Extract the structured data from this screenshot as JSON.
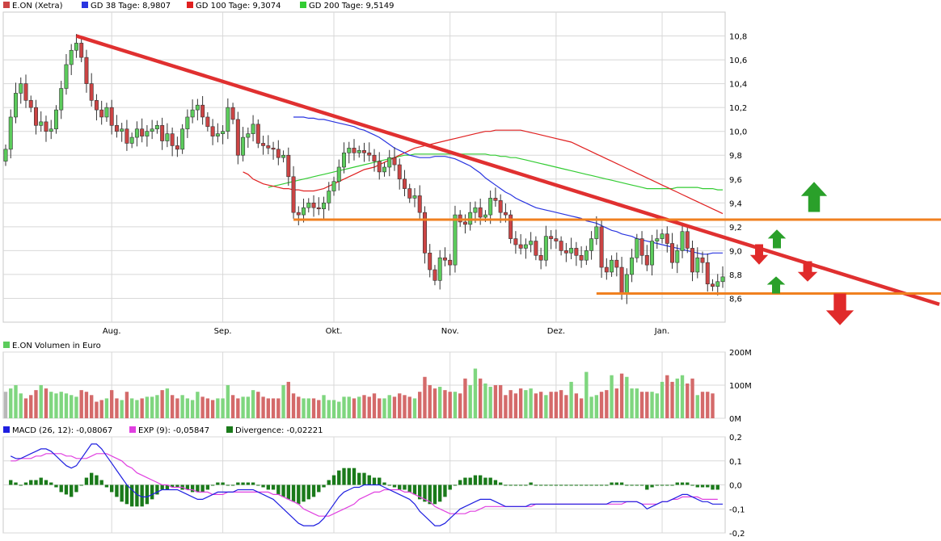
{
  "colors": {
    "bull": "#5ccc5c",
    "bear": "#cc4444",
    "sma38": "#2a35e0",
    "sma100": "#e02020",
    "sma200": "#33cc33",
    "trendline": "#e03030",
    "support": "#f08020",
    "arrow_up": "#2aa02a",
    "arrow_down": "#e02a2a",
    "vol_bull": "#7fd67f",
    "vol_bear": "#d46a6a",
    "vol_neutral": "#b8b8b8",
    "macd": "#2020e0",
    "signal": "#e040e0",
    "divergence": "#1a7a1a",
    "grid": "#d8d8d8"
  },
  "chart_data": [
    {
      "type": "candlestick",
      "legend": [
        {
          "label": "E.ON (Xetra)",
          "color": "#cc4444"
        },
        {
          "label": "GD 38 Tage: 8,9807",
          "color": "#2a35e0"
        },
        {
          "label": "GD 100 Tage: 9,3074",
          "color": "#e02020"
        },
        {
          "label": "GD 200 Tage: 9,5149",
          "color": "#33cc33"
        }
      ],
      "ylim": [
        8.4,
        11.0
      ],
      "yticks": [
        "10,8",
        "10,6",
        "10,4",
        "10,2",
        "10,0",
        "9,8",
        "9,6",
        "9,4",
        "9,2",
        "9,0",
        "8,8",
        "8,6"
      ],
      "ytick_values": [
        10.8,
        10.6,
        10.4,
        10.2,
        10.0,
        9.8,
        9.6,
        9.4,
        9.2,
        9.0,
        8.8,
        8.6
      ],
      "months": [
        {
          "label": "Aug.",
          "index": 21
        },
        {
          "label": "Sep.",
          "index": 43
        },
        {
          "label": "Okt.",
          "index": 65
        },
        {
          "label": "Nov.",
          "index": 88
        },
        {
          "label": "Dez.",
          "index": 109
        },
        {
          "label": "Jan.",
          "index": 130
        }
      ],
      "closes": [
        9.85,
        10.12,
        10.32,
        10.4,
        10.26,
        10.2,
        10.05,
        10.08,
        10.0,
        10.02,
        10.18,
        10.36,
        10.56,
        10.68,
        10.74,
        10.62,
        10.4,
        10.26,
        10.18,
        10.12,
        10.2,
        10.05,
        10.0,
        10.02,
        9.9,
        9.95,
        10.02,
        9.96,
        10.0,
        10.02,
        10.05,
        9.92,
        9.98,
        9.88,
        9.85,
        10.02,
        10.12,
        10.18,
        10.22,
        10.12,
        10.04,
        9.96,
        9.98,
        10.0,
        10.2,
        10.1,
        9.8,
        9.95,
        9.98,
        10.06,
        9.9,
        9.88,
        9.86,
        9.85,
        9.78,
        9.8,
        9.62,
        9.32,
        9.3,
        9.36,
        9.4,
        9.36,
        9.35,
        9.4,
        9.5,
        9.58,
        9.7,
        9.82,
        9.86,
        9.82,
        9.84,
        9.82,
        9.8,
        9.75,
        9.66,
        9.7,
        9.78,
        9.72,
        9.6,
        9.52,
        9.44,
        9.46,
        9.32,
        8.98,
        8.84,
        8.75,
        8.94,
        8.92,
        8.88,
        9.3,
        9.24,
        9.22,
        9.32,
        9.36,
        9.28,
        9.3,
        9.44,
        9.42,
        9.32,
        9.3,
        9.1,
        9.05,
        9.02,
        9.05,
        9.08,
        8.96,
        8.92,
        9.12,
        9.1,
        9.08,
        9.0,
        8.98,
        9.02,
        8.96,
        8.92,
        9.0,
        9.1,
        9.2,
        8.86,
        8.82,
        8.92,
        8.86,
        8.64,
        8.8,
        8.94,
        9.1,
        8.96,
        8.88,
        9.08,
        9.1,
        9.14,
        9.06,
        8.9,
        9.0,
        9.16,
        9.02,
        8.82,
        8.94,
        8.9,
        8.72,
        8.7,
        8.74,
        8.78
      ],
      "sma38": [
        null,
        null,
        null,
        null,
        null,
        null,
        null,
        null,
        null,
        null,
        null,
        null,
        null,
        null,
        null,
        null,
        null,
        null,
        null,
        null,
        null,
        null,
        null,
        null,
        null,
        null,
        null,
        null,
        null,
        null,
        null,
        null,
        null,
        null,
        null,
        null,
        null,
        null,
        10.12,
        10.12,
        10.12,
        10.11,
        10.11,
        10.1,
        10.1,
        10.09,
        10.08,
        10.07,
        10.06,
        10.05,
        10.04,
        10.02,
        10.01,
        9.99,
        9.97,
        9.95,
        9.92,
        9.89,
        9.86,
        9.84,
        9.82,
        9.8,
        9.79,
        9.78,
        9.78,
        9.78,
        9.79,
        9.79,
        9.79,
        9.78,
        9.77,
        9.75,
        9.73,
        9.71,
        9.68,
        9.65,
        9.61,
        9.58,
        9.55,
        9.52,
        9.49,
        9.47,
        9.44,
        9.42,
        9.4,
        9.38,
        9.36,
        9.35,
        9.34,
        9.33,
        9.32,
        9.31,
        9.3,
        9.29,
        9.28,
        9.27,
        9.25,
        9.24,
        9.23,
        9.21,
        9.19,
        9.17,
        9.16,
        9.14,
        9.13,
        9.12,
        9.1,
        9.09,
        9.08,
        9.07,
        9.06,
        9.05,
        9.04,
        9.03,
        9.02,
        9.01,
        9.0,
        8.99,
        8.98,
        8.97,
        8.97,
        8.98,
        8.98,
        8.98
      ],
      "sma100": [
        9.66,
        9.64,
        9.6,
        9.58,
        9.56,
        9.55,
        9.54,
        9.53,
        9.52,
        9.52,
        9.51,
        9.51,
        9.5,
        9.5,
        9.5,
        9.51,
        9.52,
        9.54,
        9.56,
        9.58,
        9.6,
        9.62,
        9.64,
        9.66,
        9.68,
        9.69,
        9.7,
        9.72,
        9.74,
        9.76,
        9.78,
        9.8,
        9.82,
        9.84,
        9.86,
        9.87,
        9.88,
        9.89,
        9.9,
        9.91,
        9.92,
        9.93,
        9.94,
        9.95,
        9.96,
        9.97,
        9.98,
        9.99,
        10.0,
        10.0,
        10.01,
        10.01,
        10.01,
        10.01,
        10.01,
        10.01,
        10.0,
        9.99,
        9.98,
        9.97,
        9.96,
        9.95,
        9.94,
        9.93,
        9.92,
        9.91,
        9.89,
        9.87,
        9.85,
        9.83,
        9.81,
        9.79,
        9.77,
        9.75,
        9.73,
        9.71,
        9.69,
        9.67,
        9.65,
        9.63,
        9.61,
        9.59,
        9.57,
        9.55,
        9.53,
        9.51,
        9.49,
        9.47,
        9.45,
        9.43,
        9.41,
        9.39,
        9.37,
        9.35,
        9.33,
        9.31
      ],
      "sma200": [
        9.53,
        9.54,
        9.55,
        9.56,
        9.57,
        9.58,
        9.59,
        9.6,
        9.61,
        9.62,
        9.63,
        9.64,
        9.65,
        9.66,
        9.67,
        9.68,
        9.69,
        9.7,
        9.71,
        9.72,
        9.73,
        9.74,
        9.75,
        9.76,
        9.77,
        9.78,
        9.79,
        9.8,
        9.8,
        9.81,
        9.81,
        9.81,
        9.81,
        9.81,
        9.81,
        9.81,
        9.81,
        9.81,
        9.81,
        9.81,
        9.81,
        9.81,
        9.81,
        9.81,
        9.8,
        9.8,
        9.79,
        9.79,
        9.78,
        9.78,
        9.77,
        9.76,
        9.75,
        9.74,
        9.73,
        9.72,
        9.71,
        9.7,
        9.69,
        9.68,
        9.67,
        9.66,
        9.65,
        9.64,
        9.63,
        9.62,
        9.61,
        9.6,
        9.59,
        9.58,
        9.57,
        9.56,
        9.55,
        9.54,
        9.53,
        9.52,
        9.52,
        9.52,
        9.52,
        9.52,
        9.52,
        9.53,
        9.53,
        9.53,
        9.53,
        9.53,
        9.52,
        9.52,
        9.52,
        9.51,
        9.51
      ]
    },
    {
      "type": "bar",
      "legend": [
        {
          "label": "E.ON Volumen in Euro",
          "color": "#5ccc5c"
        }
      ],
      "yticks": [
        "200M",
        "100M",
        "0M"
      ],
      "ytick_values": [
        200,
        100,
        0
      ],
      "ylim": [
        0,
        200
      ],
      "values": [
        80,
        90,
        100,
        75,
        60,
        70,
        85,
        100,
        90,
        80,
        75,
        80,
        75,
        70,
        65,
        85,
        80,
        70,
        50,
        55,
        60,
        85,
        60,
        55,
        80,
        60,
        55,
        60,
        65,
        65,
        70,
        85,
        90,
        70,
        60,
        70,
        60,
        55,
        80,
        65,
        60,
        55,
        60,
        60,
        100,
        70,
        60,
        65,
        65,
        85,
        80,
        65,
        60,
        60,
        60,
        100,
        110,
        75,
        65,
        60,
        60,
        60,
        55,
        70,
        55,
        55,
        50,
        65,
        65,
        60,
        65,
        70,
        65,
        75,
        60,
        60,
        70,
        65,
        75,
        70,
        65,
        60,
        80,
        125,
        100,
        90,
        95,
        85,
        80,
        80,
        75,
        120,
        100,
        150,
        120,
        105,
        95,
        100,
        100,
        70,
        85,
        75,
        90,
        85,
        90,
        75,
        80,
        70,
        80,
        80,
        85,
        70,
        110,
        75,
        60,
        140,
        65,
        70,
        80,
        85,
        130,
        90,
        135,
        125,
        90,
        90,
        80,
        80,
        80,
        75,
        110,
        130,
        110,
        120,
        130,
        105,
        120,
        70,
        80,
        80,
        75
      ]
    },
    {
      "type": "line",
      "legend": [
        {
          "label": "MACD (26, 12): -0,08067",
          "color": "#2020e0"
        },
        {
          "label": "EXP (9): -0,05847",
          "color": "#e040e0"
        },
        {
          "label": "Divergence: -0,02221",
          "color": "#1a7a1a"
        }
      ],
      "ylim": [
        -0.2,
        0.2
      ],
      "yticks": [
        "0,2",
        "0,1",
        "0,0",
        "-0,1",
        "-0,2"
      ],
      "ytick_values": [
        0.2,
        0.1,
        0.0,
        -0.1,
        -0.2
      ],
      "macd": [
        0.12,
        0.11,
        0.11,
        0.12,
        0.13,
        0.14,
        0.15,
        0.15,
        0.14,
        0.12,
        0.1,
        0.08,
        0.07,
        0.08,
        0.11,
        0.14,
        0.17,
        0.17,
        0.15,
        0.12,
        0.09,
        0.06,
        0.03,
        0.0,
        -0.02,
        -0.04,
        -0.05,
        -0.05,
        -0.04,
        -0.03,
        -0.02,
        -0.02,
        -0.02,
        -0.02,
        -0.03,
        -0.04,
        -0.05,
        -0.06,
        -0.06,
        -0.05,
        -0.04,
        -0.03,
        -0.03,
        -0.03,
        -0.03,
        -0.02,
        -0.02,
        -0.02,
        -0.02,
        -0.03,
        -0.04,
        -0.05,
        -0.06,
        -0.08,
        -0.1,
        -0.12,
        -0.14,
        -0.16,
        -0.17,
        -0.17,
        -0.17,
        -0.16,
        -0.14,
        -0.11,
        -0.08,
        -0.05,
        -0.03,
        -0.02,
        -0.01,
        -0.01,
        0.0,
        0.0,
        0.0,
        0.0,
        -0.01,
        -0.02,
        -0.03,
        -0.04,
        -0.05,
        -0.06,
        -0.08,
        -0.11,
        -0.13,
        -0.15,
        -0.17,
        -0.17,
        -0.16,
        -0.14,
        -0.12,
        -0.1,
        -0.09,
        -0.08,
        -0.07,
        -0.06,
        -0.06,
        -0.06,
        -0.07,
        -0.08,
        -0.09,
        -0.09,
        -0.09,
        -0.09,
        -0.09,
        -0.08,
        -0.08,
        -0.08,
        -0.08,
        -0.08,
        -0.08,
        -0.08,
        -0.08,
        -0.08,
        -0.08,
        -0.08,
        -0.08,
        -0.08,
        -0.08,
        -0.08,
        -0.08,
        -0.07,
        -0.07,
        -0.07,
        -0.07,
        -0.07,
        -0.07,
        -0.08,
        -0.1,
        -0.09,
        -0.08,
        -0.07,
        -0.07,
        -0.06,
        -0.05,
        -0.04,
        -0.04,
        -0.05,
        -0.06,
        -0.07,
        -0.07,
        -0.08,
        -0.08,
        -0.08
      ],
      "signal": [
        0.1,
        0.1,
        0.11,
        0.11,
        0.11,
        0.12,
        0.12,
        0.13,
        0.13,
        0.13,
        0.13,
        0.12,
        0.12,
        0.11,
        0.11,
        0.11,
        0.12,
        0.13,
        0.13,
        0.13,
        0.12,
        0.11,
        0.1,
        0.08,
        0.07,
        0.05,
        0.04,
        0.03,
        0.02,
        0.01,
        0.0,
        0.0,
        -0.01,
        -0.01,
        -0.01,
        -0.02,
        -0.02,
        -0.03,
        -0.03,
        -0.03,
        -0.04,
        -0.04,
        -0.04,
        -0.03,
        -0.03,
        -0.03,
        -0.03,
        -0.03,
        -0.03,
        -0.03,
        -0.03,
        -0.03,
        -0.04,
        -0.04,
        -0.05,
        -0.06,
        -0.07,
        -0.08,
        -0.1,
        -0.11,
        -0.12,
        -0.13,
        -0.13,
        -0.13,
        -0.12,
        -0.11,
        -0.1,
        -0.09,
        -0.08,
        -0.06,
        -0.05,
        -0.04,
        -0.03,
        -0.03,
        -0.02,
        -0.02,
        -0.02,
        -0.02,
        -0.03,
        -0.03,
        -0.04,
        -0.05,
        -0.06,
        -0.07,
        -0.09,
        -0.1,
        -0.11,
        -0.12,
        -0.12,
        -0.12,
        -0.12,
        -0.11,
        -0.11,
        -0.1,
        -0.09,
        -0.09,
        -0.09,
        -0.09,
        -0.09,
        -0.09,
        -0.09,
        -0.09,
        -0.09,
        -0.09,
        -0.08,
        -0.08,
        -0.08,
        -0.08,
        -0.08,
        -0.08,
        -0.08,
        -0.08,
        -0.08,
        -0.08,
        -0.08,
        -0.08,
        -0.08,
        -0.08,
        -0.08,
        -0.08,
        -0.08,
        -0.08,
        -0.07,
        -0.07,
        -0.07,
        -0.08,
        -0.08,
        -0.08,
        -0.08,
        -0.07,
        -0.07,
        -0.06,
        -0.06,
        -0.05,
        -0.05,
        -0.05,
        -0.05,
        -0.06,
        -0.06,
        -0.06,
        -0.06
      ]
    }
  ]
}
